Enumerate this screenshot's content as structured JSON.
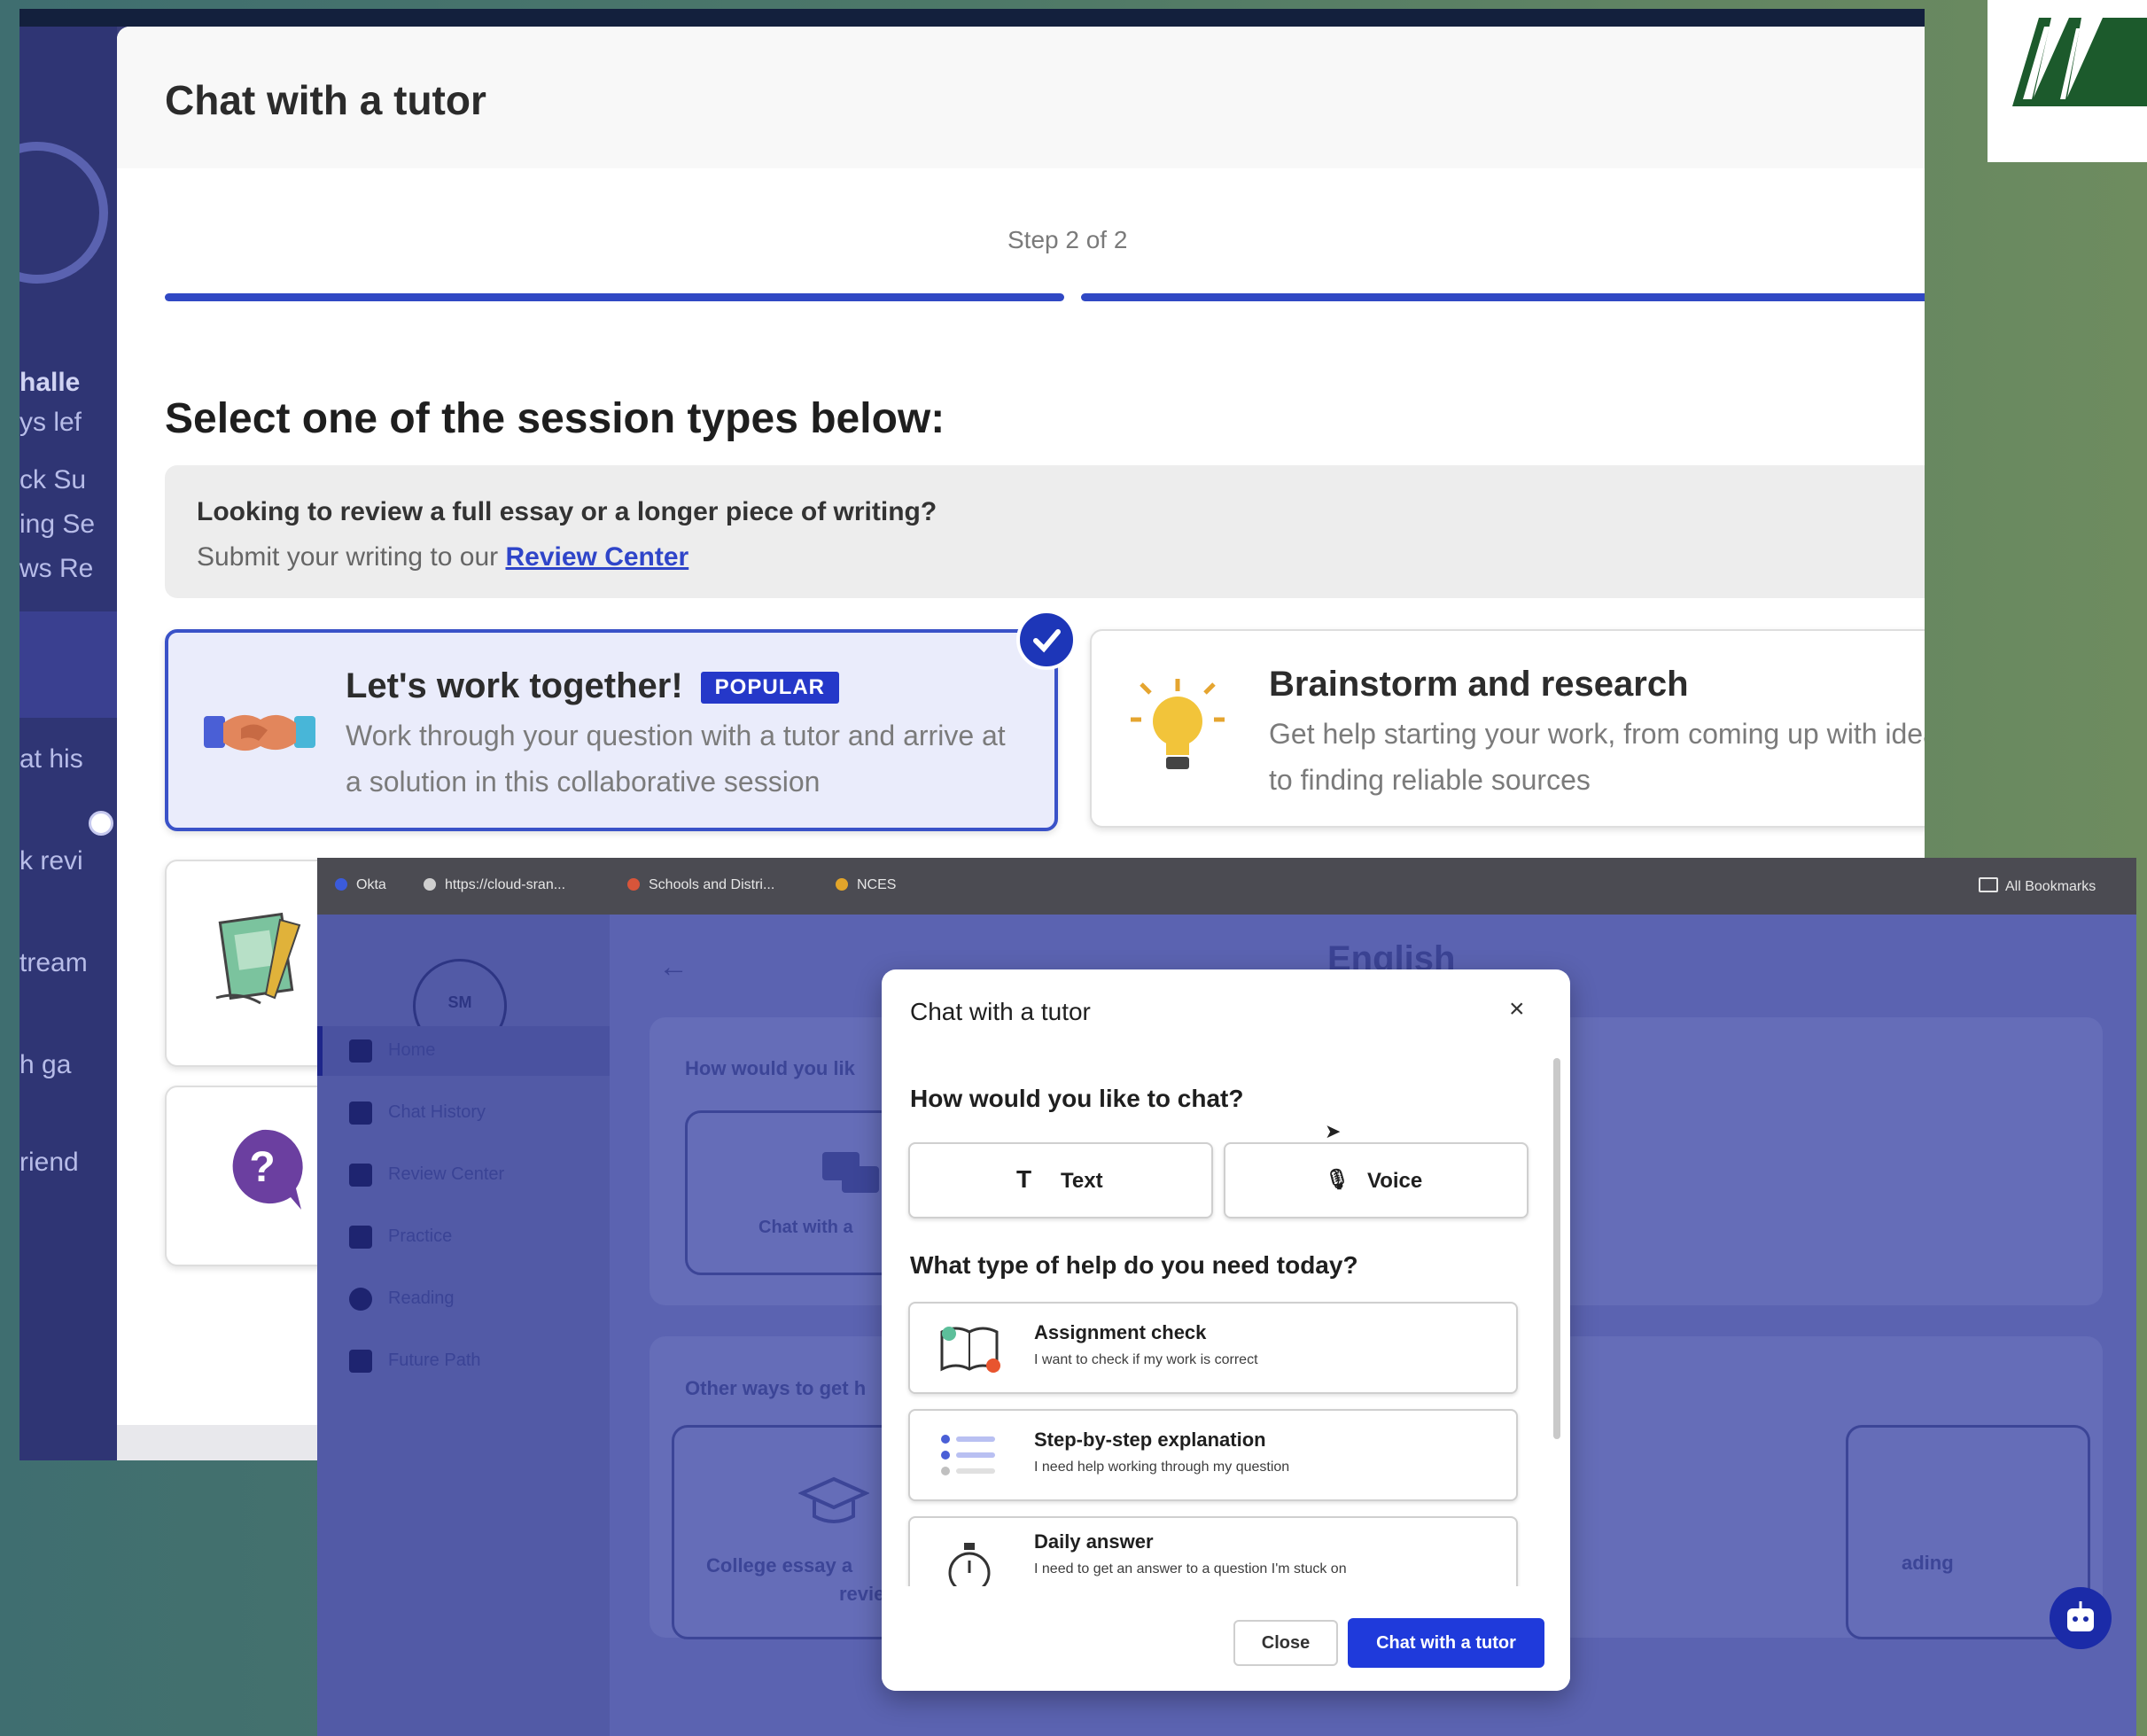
{
  "back": {
    "sidebar_fragments": [
      "halle",
      "ys lef",
      "ck Su",
      "ing Se",
      "ws Re",
      "at his",
      "k revi",
      "tream",
      "h ga",
      "riend"
    ],
    "modal": {
      "title": "Chat with a tutor",
      "step": "Step 2 of 2",
      "heading": "Select one of the session types below:",
      "info_line1": "Looking to review a full essay or a longer piece of writing?",
      "info_line2_prefix": "Submit your writing to our",
      "info_link": "Review Center",
      "cards": [
        {
          "title": "Let's work together!",
          "badge": "POPULAR",
          "description": "Work through your question with a tutor and arrive at a solution in this collaborative session",
          "icon": "handshake-icon",
          "selected": true
        },
        {
          "title": "Brainstorm and research",
          "description": "Get help starting your work, from coming up with ideas to finding reliable sources",
          "icon": "lightbulb-icon",
          "selected": false
        }
      ]
    }
  },
  "front": {
    "bookmarks": [
      "Okta",
      "https://cloud-sran...",
      "Schools and Distri...",
      "NCES"
    ],
    "bookmarks_all": "All Bookmarks",
    "avatar_initials": "SM",
    "nav": [
      {
        "label": "Home",
        "icon": "home-icon",
        "active": true
      },
      {
        "label": "Chat History",
        "icon": "chat-history-icon",
        "active": false
      },
      {
        "label": "Review Center",
        "icon": "document-icon",
        "active": false
      },
      {
        "label": "Practice",
        "icon": "grid-icon",
        "active": false
      },
      {
        "label": "Reading",
        "icon": "reading-icon",
        "active": false
      },
      {
        "label": "Future Path",
        "icon": "briefcase-icon",
        "active": false
      }
    ],
    "page_title": "English",
    "panel1_label": "How would you lik",
    "chat_option_label": "Chat with a",
    "panel2_label": "Other ways to get h",
    "college_label_1": "College essay a",
    "college_label_2": "review",
    "reading_label": "ading",
    "dialog": {
      "title": "Chat with a tutor",
      "close_glyph": "×",
      "q1": "How would you like to chat?",
      "modes": [
        {
          "label": "Text",
          "icon_glyph": "T"
        },
        {
          "label": "Voice",
          "icon_glyph": "🎙"
        }
      ],
      "q2": "What type of help do you need today?",
      "help_options": [
        {
          "title": "Assignment check",
          "subtitle": "I want to check if my work is correct",
          "icon": "book-check-icon"
        },
        {
          "title": "Step-by-step explanation",
          "subtitle": "I need help working through my question",
          "icon": "checklist-icon"
        },
        {
          "title": "Daily answer",
          "subtitle": "I need to get an answer to a question I'm stuck on",
          "icon": "timer-icon"
        }
      ],
      "close_button": "Close",
      "primary_button": "Chat with a tutor"
    }
  },
  "colors": {
    "accent": "#2538c9",
    "app_bg": "#5b63b1",
    "primary_button": "#1f3adb"
  }
}
